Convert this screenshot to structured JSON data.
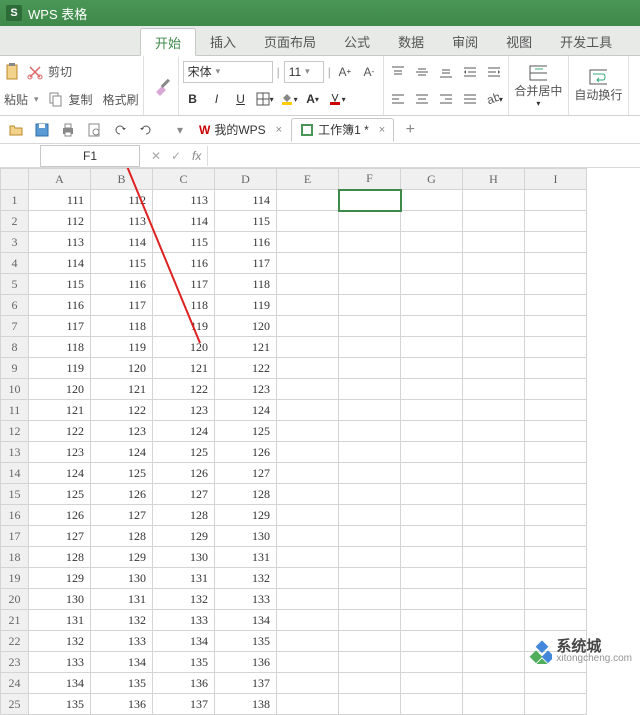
{
  "app": {
    "logo_text": "S",
    "title": "WPS 表格"
  },
  "menu_tabs": {
    "active": "开始",
    "items": [
      "开始",
      "插入",
      "页面布局",
      "公式",
      "数据",
      "审阅",
      "视图",
      "开发工具"
    ]
  },
  "ribbon": {
    "paste": "粘贴",
    "cut": "剪切",
    "copy": "复制",
    "format_painter": "格式刷",
    "font_name": "宋体",
    "font_size": "11",
    "merge": "合并居中",
    "wrap": "自动换行"
  },
  "doc_tabs": {
    "wps_home": "我的WPS",
    "book": "工作簿1 *"
  },
  "name_box": {
    "ref": "F1"
  },
  "columns": [
    "A",
    "B",
    "C",
    "D",
    "E",
    "F",
    "G",
    "H",
    "I"
  ],
  "selected_cell": {
    "col": "F",
    "row": 1
  },
  "chart_data": {
    "type": "table",
    "columns": [
      "A",
      "B",
      "C",
      "D"
    ],
    "rows": [
      [
        111,
        112,
        113,
        114
      ],
      [
        112,
        113,
        114,
        115
      ],
      [
        113,
        114,
        115,
        116
      ],
      [
        114,
        115,
        116,
        117
      ],
      [
        115,
        116,
        117,
        118
      ],
      [
        116,
        117,
        118,
        119
      ],
      [
        117,
        118,
        119,
        120
      ],
      [
        118,
        119,
        120,
        121
      ],
      [
        119,
        120,
        121,
        122
      ],
      [
        120,
        121,
        122,
        123
      ],
      [
        121,
        122,
        123,
        124
      ],
      [
        122,
        123,
        124,
        125
      ],
      [
        123,
        124,
        125,
        126
      ],
      [
        124,
        125,
        126,
        127
      ],
      [
        125,
        126,
        127,
        128
      ],
      [
        126,
        127,
        128,
        129
      ],
      [
        127,
        128,
        129,
        130
      ],
      [
        128,
        129,
        130,
        131
      ],
      [
        129,
        130,
        131,
        132
      ],
      [
        130,
        131,
        132,
        133
      ],
      [
        131,
        132,
        133,
        134
      ],
      [
        132,
        133,
        134,
        135
      ],
      [
        133,
        134,
        135,
        136
      ],
      [
        134,
        135,
        136,
        137
      ],
      [
        135,
        136,
        137,
        138
      ]
    ]
  },
  "watermark": {
    "title": "系统城",
    "url": "xitongcheng.com"
  }
}
